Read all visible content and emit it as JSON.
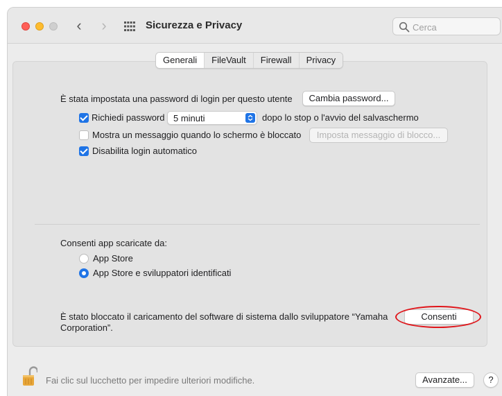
{
  "window": {
    "title": "Sicurezza e Privacy",
    "nav_back": "‹",
    "nav_forward": "›",
    "search_placeholder": "Cerca",
    "traffic_colors": {
      "close": "#ff5f57",
      "minimize": "#febc2e",
      "maximize": "#cfcfcf"
    }
  },
  "tabs": [
    {
      "label": "Generali",
      "selected": true
    },
    {
      "label": "FileVault",
      "selected": false
    },
    {
      "label": "Firewall",
      "selected": false
    },
    {
      "label": "Privacy",
      "selected": false
    }
  ],
  "general": {
    "password_set_text": "È stata impostata una password di login per questo utente",
    "change_password_button": "Cambia password...",
    "require_password": {
      "checked": true,
      "label": "Richiedi password",
      "select_value": "5 minuti",
      "suffix": "dopo lo stop o l'avvio del salvaschermo"
    },
    "show_message": {
      "checked": false,
      "label": "Mostra un messaggio quando lo schermo è bloccato",
      "button": "Imposta messaggio di blocco..."
    },
    "disable_auto_login": {
      "checked": true,
      "label": "Disabilita login automatico"
    }
  },
  "downloads": {
    "heading": "Consenti app scaricate da:",
    "options": [
      {
        "label": "App Store",
        "selected": false
      },
      {
        "label": "App Store e sviluppatori identificati",
        "selected": true
      }
    ]
  },
  "blocked": {
    "text_line1": "È stato bloccato il caricamento del software di sistema dallo sviluppatore “Yamaha",
    "text_line2": "Corporation”.",
    "allow_button": "Consenti",
    "highlight_color": "#e0161b"
  },
  "footer": {
    "lock_text": "Fai clic sul lucchetto per impedire ulteriori modifiche.",
    "advanced_button": "Avanzate...",
    "help_button": "?"
  },
  "accent_color": "#1f74e6"
}
